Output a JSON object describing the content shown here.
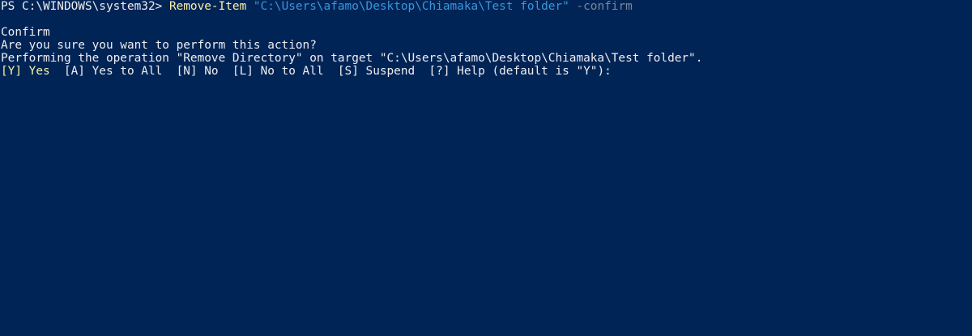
{
  "console": {
    "prompt_prefix": "PS C:\\WINDOWS\\system32> ",
    "command": {
      "cmdlet": "Remove-Item",
      "path_argument": "\"C:\\Users\\afamo\\Desktop\\Chiamaka\\Test folder\"",
      "parameter": "-confirm"
    },
    "confirm_block": {
      "title": "Confirm",
      "question": "Are you sure you want to perform this action?",
      "operation": "Performing the operation \"Remove Directory\" on target \"C:\\Users\\afamo\\Desktop\\Chiamaka\\Test folder\".",
      "options": {
        "yes": "[Y] Yes",
        "rest": "  [A] Yes to All  [N] No  [L] No to All  [S] Suspend  [?] Help (default is \"Y\"):"
      }
    }
  },
  "colors": {
    "background": "#012456",
    "foreground": "#eeedf0",
    "cmdlet": "#f9f1a5",
    "string": "#3a96dd",
    "parameter": "#7b8898"
  }
}
